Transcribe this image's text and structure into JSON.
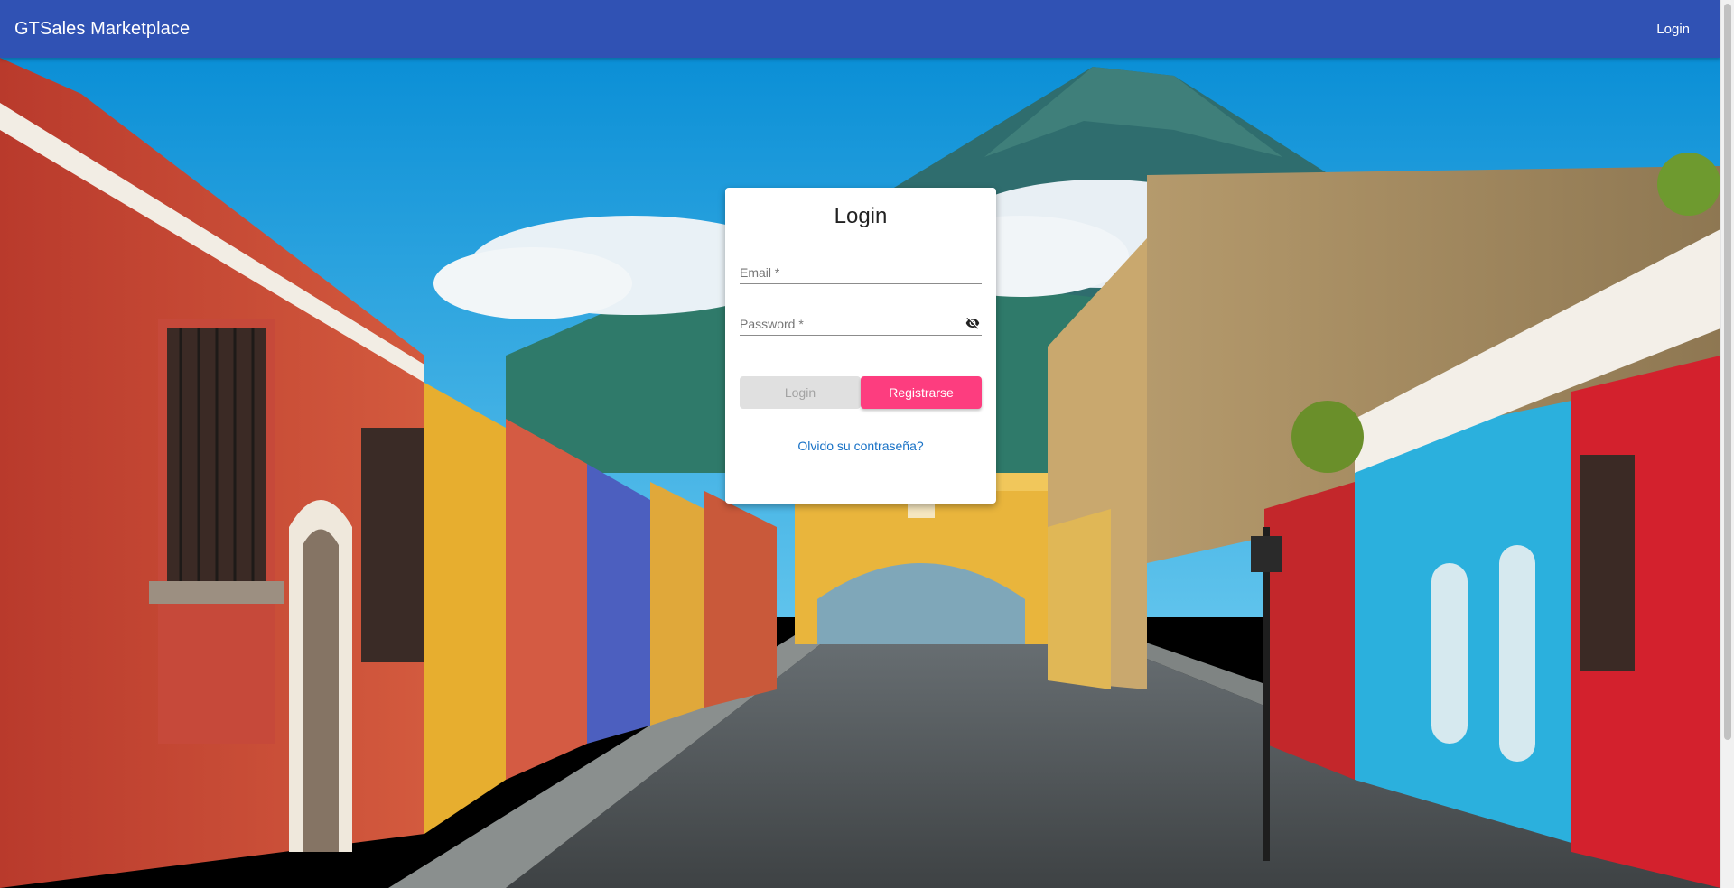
{
  "header": {
    "brand": "GTSales Marketplace",
    "login_link": "Login"
  },
  "login_card": {
    "title": "Login",
    "email_label": "Email *",
    "password_label": "Password *",
    "login_button": "Login",
    "register_button": "Registrarse",
    "forgot_link": "Olvido su contraseña?"
  },
  "icons": {
    "password_toggle": "eye-off-icon"
  },
  "colors": {
    "toolbar": "#3052b4",
    "register_button": "#fd3d7f",
    "login_button_disabled": "#e0e0e0",
    "link": "#1771c6"
  }
}
